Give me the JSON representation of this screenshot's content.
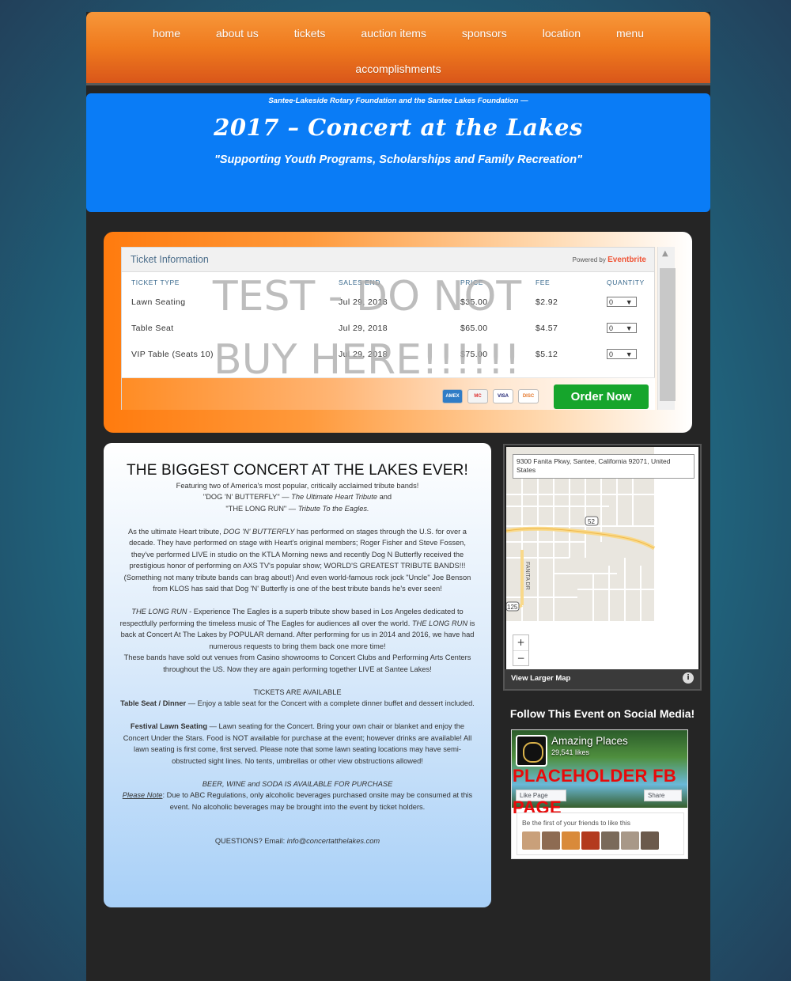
{
  "nav": {
    "row1": [
      "home",
      "about us",
      "tickets",
      "auction items",
      "sponsors",
      "location",
      "menu"
    ],
    "row2": [
      "accomplishments"
    ]
  },
  "header": {
    "subtitle": "Santee-Lakeside Rotary Foundation and the Santee Lakes Foundation —",
    "title": "2017 – Concert at the Lakes",
    "tagline": "\"Supporting Youth Programs, Scholarships and Family Recreation\""
  },
  "ticket_widget": {
    "title": "Ticket Information",
    "powered_by": "Powered by",
    "brand": "Eventbrite",
    "columns": [
      "TICKET TYPE",
      "SALES END",
      "PRICE",
      "FEE",
      "QUANTITY"
    ],
    "rows": [
      {
        "type": "Lawn Seating",
        "sales_end": "Jul 29, 2018",
        "price": "$35.00",
        "fee": "$2.92",
        "qty": "0"
      },
      {
        "type": "Table Seat",
        "sales_end": "Jul 29, 2018",
        "price": "$65.00",
        "fee": "$4.57",
        "qty": "0"
      },
      {
        "type": "VIP Table (Seats 10)",
        "sales_end": "Jul 29, 2018",
        "price": "$75.00",
        "fee": "$5.12",
        "qty": "0"
      }
    ],
    "overlay_line1": "TEST - DO NOT",
    "overlay_line2": "BUY HERE!!!!!!",
    "cards": [
      "AMEX",
      "MC",
      "VISA",
      "DISC"
    ],
    "order_button": "Order Now",
    "scroll_up": "▲",
    "qty_arrow": "▼"
  },
  "content": {
    "heading": "THE BIGGEST CONCERT AT THE LAKES EVER!",
    "intro1": "Featuring two of America's most popular, critically acclaimed tribute bands!",
    "band1_name": "\"DOG 'N' BUTTERFLY\"",
    "band1_dash": " — ",
    "band1_desc": "The Ultimate Heart Tribute",
    "and": " and",
    "band2_name": "\"THE LONG RUN\"",
    "band2_dash": " — ",
    "band2_desc": "Tribute To the Eagles.",
    "para1_a": "As the ultimate Heart tribute, ",
    "para1_band": "DOG 'N' BUTTERFLY",
    "para1_b": " has performed on stages through the U.S. for over a decade. They have performed on stage with Heart's original members; Roger Fisher and Steve Fossen, they've performed LIVE in studio on the KTLA Morning news and recently Dog N Butterfly received the prestigious honor of performing on AXS TV's popular show; WORLD'S GREATEST TRIBUTE BANDS!!! (Something not many tribute bands can brag about!) And even world-famous rock jock \"Uncle\" Joe Benson from KLOS has said that Dog 'N' Butterfly is one of the best tribute bands he's ever seen!",
    "para2_band": "THE LONG RUN",
    "para2_a": " - Experience The Eagles is a superb tribute show based in Los Angeles dedicated to respectfully performing the timeless music of The Eagles for audiences all over the world. ",
    "para2_band2": "THE LONG RUN",
    "para2_b": " is back at Concert At The Lakes by POPULAR demand. After performing for us in 2014 and 2016, we have had numerous requests to bring them back one more time!",
    "para2_c": "These bands have sold out venues from Casino showrooms to Concert Clubs and Performing Arts Centers throughout the US. Now they are again performing together LIVE at Santee Lakes!",
    "tickets_heading": "TICKETS ARE AVAILABLE",
    "table_label": "Table Seat / Dinner",
    "table_text": " — Enjoy a table seat for the Concert with a complete dinner buffet and dessert included.",
    "lawn_label": "Festival Lawn Seating",
    "lawn_text": " — Lawn seating for the Concert. Bring your own chair or blanket and enjoy the Concert Under the Stars. Food is NOT available for purchase at the event; however drinks are available! All lawn seating is first come, first served. Please note that some lawn seating locations may have semi-obstructed sight lines. No tents, umbrellas or other view obstructions allowed!",
    "beer_line": "BEER, WINE and SODA IS AVAILABLE FOR PURCHASE",
    "note_label": "Please Note",
    "note_text": ": Due to ABC Regulations, only alcoholic beverages purchased onsite may be consumed at this event. No alcoholic beverages may be brought into the event by ticket holders.",
    "questions": "QUESTIONS?   Email:   ",
    "email": "info@concertatthelakes.com"
  },
  "map": {
    "address": "9300 Fanita Pkwy, Santee, California 92071, United States",
    "route_52": "52",
    "route_125": "125",
    "street": "FANITA DR",
    "zoom_in": "+",
    "zoom_out": "−",
    "larger_link": "View Larger Map",
    "info": "i"
  },
  "social": {
    "title": "Follow This Event on Social Media!",
    "page_name": "Amazing Places",
    "likes": "29,541 likes",
    "like_button": "Like Page",
    "share_button": "Share",
    "placeholder_line1": "PLACEHOLDER FB",
    "placeholder_line2": "PAGE",
    "friends_text": "Be the first of your friends to like this"
  },
  "colors": {
    "nav_orange": "#ef7a1e",
    "header_blue": "#0a7cf6",
    "order_green": "#16a52c",
    "placeholder_red": "#e80a0a"
  }
}
